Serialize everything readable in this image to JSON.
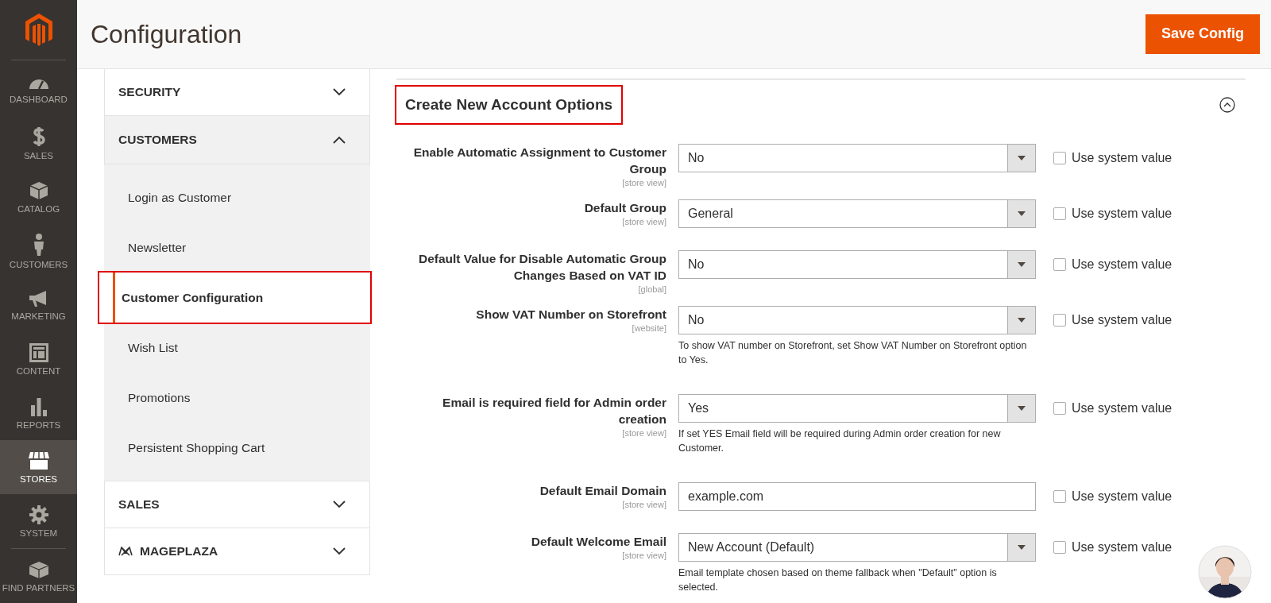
{
  "nav": [
    {
      "label": "DASHBOARD",
      "selected": false
    },
    {
      "label": "SALES",
      "selected": false
    },
    {
      "label": "CATALOG",
      "selected": false
    },
    {
      "label": "CUSTOMERS",
      "selected": false
    },
    {
      "label": "MARKETING",
      "selected": false
    },
    {
      "label": "CONTENT",
      "selected": false
    },
    {
      "label": "REPORTS",
      "selected": false
    },
    {
      "label": "STORES",
      "selected": true
    },
    {
      "label": "SYSTEM",
      "selected": false
    },
    {
      "label": "FIND PARTNERS",
      "selected": false
    }
  ],
  "header": {
    "title": "Configuration",
    "save_button": "Save Config"
  },
  "config_menu": [
    {
      "label": "SECURITY",
      "expanded": false
    },
    {
      "label": "CUSTOMERS",
      "expanded": true,
      "children": [
        {
          "label": "Login as Customer",
          "selected": false,
          "annotated": false
        },
        {
          "label": "Newsletter",
          "selected": false,
          "annotated": false
        },
        {
          "label": "Customer Configuration",
          "selected": true,
          "annotated": true
        },
        {
          "label": "Wish List",
          "selected": false,
          "annotated": false
        },
        {
          "label": "Promotions",
          "selected": false,
          "annotated": false
        },
        {
          "label": "Persistent Shopping Cart",
          "selected": false,
          "annotated": false
        }
      ]
    },
    {
      "label": "SALES",
      "expanded": false
    },
    {
      "label": "MAGEPLAZA",
      "expanded": false,
      "logo": true
    }
  ],
  "section": {
    "title": "Create New Account Options",
    "annotated": true,
    "expanded": true
  },
  "fields": [
    {
      "kind": "select",
      "label": "Enable Automatic Assignment to Customer Group",
      "scope": "[store view]",
      "value": "No",
      "checkbox_label": "Use system value",
      "use_system_value": false
    },
    {
      "kind": "select",
      "label": "Default Group",
      "scope": "[store view]",
      "value": "General",
      "checkbox_label": "Use system value",
      "use_system_value": false
    },
    {
      "kind": "select",
      "label": "Default Value for Disable Automatic Group Changes Based on VAT ID",
      "scope": "[global]",
      "value": "No",
      "checkbox_label": "Use system value",
      "use_system_value": false
    },
    {
      "kind": "select",
      "label": "Show VAT Number on Storefront",
      "scope": "[website]",
      "value": "No",
      "note": "To show VAT number on Storefront, set Show VAT Number on Storefront option to Yes.",
      "checkbox_label": "Use system value",
      "use_system_value": false
    },
    {
      "kind": "select",
      "label": "Email is required field for Admin order creation",
      "scope": "[store view]",
      "value": "Yes",
      "note": "If set YES Email field will be required during Admin order creation for new Customer.",
      "checkbox_label": "Use system value",
      "use_system_value": false
    },
    {
      "kind": "text",
      "label": "Default Email Domain",
      "scope": "[store view]",
      "value": "example.com",
      "checkbox_label": "Use system value",
      "use_system_value": false
    },
    {
      "kind": "select",
      "label": "Default Welcome Email",
      "scope": "[store view]",
      "value": "New Account (Default)",
      "note": "Email template chosen based on theme fallback when \"Default\" option is selected.",
      "checkbox_label": "Use system value",
      "use_system_value": false
    }
  ]
}
